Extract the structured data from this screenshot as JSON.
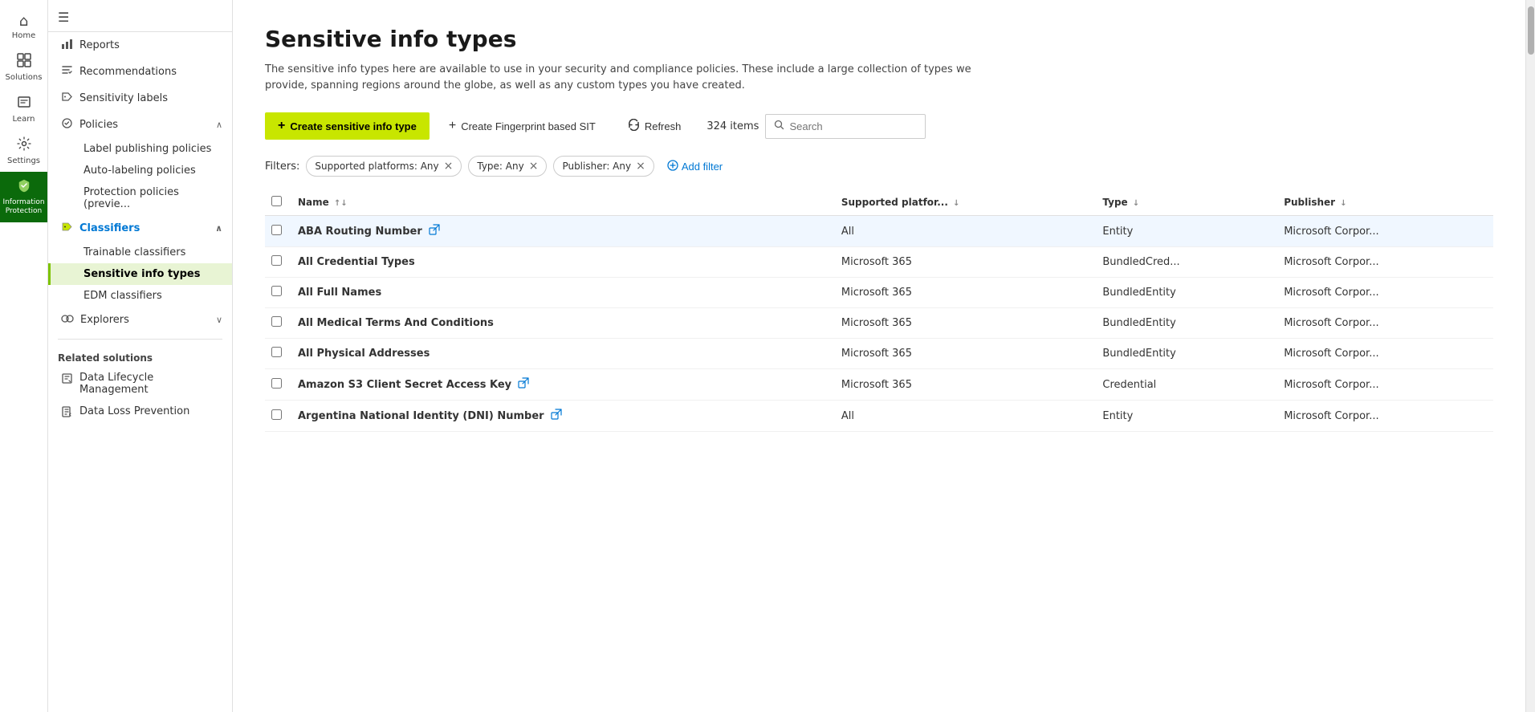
{
  "iconNav": {
    "items": [
      {
        "id": "home",
        "label": "Home",
        "icon": "⌂",
        "active": false
      },
      {
        "id": "solutions",
        "label": "Solutions",
        "icon": "⊞",
        "active": false
      },
      {
        "id": "learn",
        "label": "Learn",
        "icon": "📖",
        "active": false
      },
      {
        "id": "settings",
        "label": "Settings",
        "icon": "⚙",
        "active": false
      },
      {
        "id": "information-protection",
        "label": "Information Protection",
        "icon": "🏷",
        "active": true
      }
    ]
  },
  "sidebar": {
    "hamburger": "☰",
    "items": [
      {
        "id": "reports",
        "label": "Reports",
        "icon": "📊",
        "type": "top"
      },
      {
        "id": "recommendations",
        "label": "Recommendations",
        "icon": "✏",
        "type": "top"
      },
      {
        "id": "sensitivity-labels",
        "label": "Sensitivity labels",
        "icon": "🏷",
        "type": "top"
      },
      {
        "id": "policies",
        "label": "Policies",
        "icon": "⚙",
        "type": "expandable",
        "expanded": true
      },
      {
        "id": "label-publishing-policies",
        "label": "Label publishing policies",
        "type": "sub"
      },
      {
        "id": "auto-labeling-policies",
        "label": "Auto-labeling policies",
        "type": "sub"
      },
      {
        "id": "protection-policies",
        "label": "Protection policies (previe...",
        "type": "sub"
      },
      {
        "id": "classifiers",
        "label": "Classifiers",
        "icon": "🏷",
        "type": "expandable",
        "expanded": true,
        "activeParent": true
      },
      {
        "id": "trainable-classifiers",
        "label": "Trainable classifiers",
        "type": "sub"
      },
      {
        "id": "sensitive-info-types",
        "label": "Sensitive info types",
        "type": "sub",
        "active": true
      },
      {
        "id": "edm-classifiers",
        "label": "EDM classifiers",
        "type": "sub"
      },
      {
        "id": "explorers",
        "label": "Explorers",
        "icon": "👁",
        "type": "expandable",
        "expanded": false
      }
    ],
    "relatedSolutions": {
      "header": "Related solutions",
      "items": [
        {
          "id": "data-lifecycle",
          "label": "Data Lifecycle\nManagement",
          "icon": "🗄"
        },
        {
          "id": "data-loss-prevention",
          "label": "Data Loss Prevention",
          "icon": "📄"
        }
      ]
    }
  },
  "page": {
    "title": "Sensitive info types",
    "description": "The sensitive info types here are available to use in your security and compliance policies. These include a large collection of types we provide, spanning regions around the globe, as well as any custom types you have created.",
    "toolbar": {
      "createButton": "Create sensitive info type",
      "fingerprintButton": "Create Fingerprint based SIT",
      "refreshButton": "Refresh",
      "itemCount": "324 items",
      "searchPlaceholder": "Search"
    },
    "filters": {
      "label": "Filters:",
      "chips": [
        {
          "id": "platforms",
          "text": "Supported platforms: Any"
        },
        {
          "id": "type",
          "text": "Type: Any"
        },
        {
          "id": "publisher",
          "text": "Publisher: Any"
        }
      ],
      "addFilter": "Add filter"
    },
    "table": {
      "columns": [
        {
          "id": "name",
          "label": "Name",
          "sortable": true
        },
        {
          "id": "supported-platforms",
          "label": "Supported platfor...",
          "sortable": true
        },
        {
          "id": "type",
          "label": "Type",
          "sortable": true
        },
        {
          "id": "publisher",
          "label": "Publisher",
          "sortable": true
        }
      ],
      "rows": [
        {
          "id": 1,
          "name": "ABA Routing Number",
          "hasLink": true,
          "platforms": "All",
          "type": "Entity",
          "publisher": "Microsoft Corpor...",
          "highlighted": true
        },
        {
          "id": 2,
          "name": "All Credential Types",
          "hasLink": false,
          "platforms": "Microsoft 365",
          "type": "BundledCred...",
          "publisher": "Microsoft Corpor..."
        },
        {
          "id": 3,
          "name": "All Full Names",
          "hasLink": false,
          "platforms": "Microsoft 365",
          "type": "BundledEntity",
          "publisher": "Microsoft Corpor..."
        },
        {
          "id": 4,
          "name": "All Medical Terms And Conditions",
          "hasLink": false,
          "platforms": "Microsoft 365",
          "type": "BundledEntity",
          "publisher": "Microsoft Corpor..."
        },
        {
          "id": 5,
          "name": "All Physical Addresses",
          "hasLink": false,
          "platforms": "Microsoft 365",
          "type": "BundledEntity",
          "publisher": "Microsoft Corpor..."
        },
        {
          "id": 6,
          "name": "Amazon S3 Client Secret Access Key",
          "hasLink": true,
          "platforms": "Microsoft 365",
          "type": "Credential",
          "publisher": "Microsoft Corpor..."
        },
        {
          "id": 7,
          "name": "Argentina National Identity (DNI) Number",
          "hasLink": true,
          "platforms": "All",
          "type": "Entity",
          "publisher": "Microsoft Corpor..."
        }
      ]
    }
  },
  "colors": {
    "activeYellow": "#c8e600",
    "activeSidebarBg": "#e8f4d4",
    "activeNavBg": "#0b6a0b",
    "linkBlue": "#0078d4"
  }
}
